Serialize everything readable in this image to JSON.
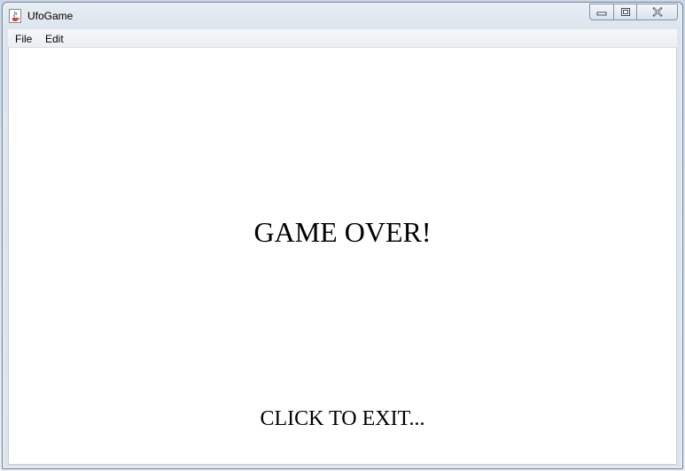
{
  "window": {
    "title": "UfoGame",
    "icon": "java-cup-icon"
  },
  "caption_buttons": {
    "minimize": "minimize-icon",
    "maximize": "maximize-icon",
    "close": "close-icon"
  },
  "menu": {
    "items": [
      {
        "label": "File"
      },
      {
        "label": "Edit"
      }
    ]
  },
  "canvas": {
    "message": "GAME OVER!",
    "prompt": "CLICK TO EXIT..."
  }
}
